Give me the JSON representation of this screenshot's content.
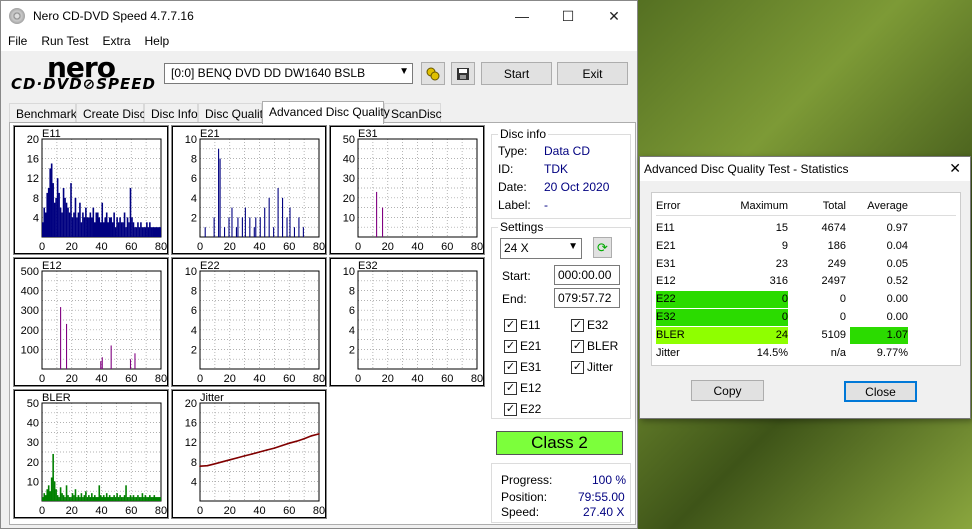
{
  "window": {
    "title": "Nero CD-DVD Speed 4.7.7.16",
    "min": "—",
    "max": "☐",
    "close": "✕"
  },
  "menu": [
    "File",
    "Run Test",
    "Extra",
    "Help"
  ],
  "logo": {
    "top": "nero",
    "bottom": "CD·DVD⊘SPEED"
  },
  "drive": {
    "value": "[0:0]   BENQ DVD DD DW1640 BSLB"
  },
  "buttons": {
    "start": "Start",
    "exit": "Exit"
  },
  "tabs": [
    "Benchmark",
    "Create Disc",
    "Disc Info",
    "Disc Quality",
    "Advanced Disc Quality",
    "ScanDisc"
  ],
  "active_tab": "Advanced Disc Quality",
  "disc_info": {
    "label": "Disc info",
    "rows": [
      {
        "k": "Type:",
        "v": "Data CD"
      },
      {
        "k": "ID:",
        "v": "TDK"
      },
      {
        "k": "Date:",
        "v": "20 Oct 2020"
      },
      {
        "k": "Label:",
        "v": "-"
      }
    ]
  },
  "settings": {
    "label": "Settings",
    "speed": "24 X",
    "start_label": "Start:",
    "start": "000:00.00",
    "end_label": "End:",
    "end": "079:57.72",
    "checks": [
      {
        "label": "E11",
        "checked": true
      },
      {
        "label": "E32",
        "checked": true
      },
      {
        "label": "E21",
        "checked": true
      },
      {
        "label": "BLER",
        "checked": true
      },
      {
        "label": "E31",
        "checked": true
      },
      {
        "label": "Jitter",
        "checked": true
      },
      {
        "label": "E12",
        "checked": true
      },
      {
        "label": "E22",
        "checked": true
      }
    ]
  },
  "class": "Class 2",
  "progress": {
    "progress_label": "Progress:",
    "progress": "100 %",
    "position_label": "Position:",
    "position": "79:55.00",
    "speed_label": "Speed:",
    "speed": "27.40 X"
  },
  "chart_data": [
    {
      "name": "E11",
      "type": "bar",
      "yticks": [
        "20",
        "16",
        "12",
        "8",
        "4"
      ],
      "xticks": [
        "0",
        "20",
        "40",
        "60",
        "80"
      ],
      "ylim": [
        0,
        20
      ],
      "color": "#000080",
      "values": [
        3,
        6,
        5,
        9,
        10,
        14,
        15,
        11,
        7,
        8,
        12,
        9,
        6,
        5,
        10,
        8,
        7,
        6,
        5,
        11,
        4,
        5,
        8,
        4,
        5,
        7,
        3,
        5,
        4,
        6,
        4,
        4,
        5,
        4,
        6,
        3,
        5,
        5,
        4,
        3,
        7,
        3,
        4,
        5,
        3,
        4,
        4,
        3,
        5,
        2,
        4,
        3,
        4,
        3,
        3,
        5,
        2,
        4,
        3,
        10,
        4,
        3,
        2,
        2,
        3,
        2,
        3,
        2,
        2,
        2,
        3,
        2,
        3,
        2,
        2,
        2,
        2,
        2,
        2,
        2
      ]
    },
    {
      "name": "E21",
      "type": "bar",
      "yticks": [
        "10",
        "8",
        "6",
        "4",
        "2"
      ],
      "xticks": [
        "0",
        "20",
        "40",
        "60",
        "80"
      ],
      "ylim": [
        0,
        10
      ],
      "color": "#000080",
      "values": [
        0,
        0,
        0,
        1,
        0,
        0,
        0,
        0,
        0,
        2,
        0,
        0,
        9,
        8,
        0,
        0,
        1,
        0,
        0,
        2,
        0,
        3,
        0,
        0,
        1,
        2,
        0,
        0,
        2,
        0,
        3,
        0,
        0,
        2,
        0,
        0,
        1,
        2,
        0,
        0,
        2,
        0,
        0,
        3,
        0,
        0,
        4,
        0,
        0,
        1,
        0,
        0,
        5,
        0,
        0,
        4,
        0,
        0,
        2,
        0,
        3,
        0,
        0,
        1,
        0,
        0,
        2,
        0,
        0,
        1,
        0,
        0,
        0,
        0,
        0,
        0,
        0,
        0,
        0,
        0
      ]
    },
    {
      "name": "E31",
      "type": "bar",
      "yticks": [
        "50",
        "40",
        "30",
        "20",
        "10"
      ],
      "xticks": [
        "0",
        "20",
        "40",
        "60",
        "80"
      ],
      "ylim": [
        0,
        50
      ],
      "color": "#800080",
      "values": [
        0,
        0,
        0,
        0,
        0,
        0,
        0,
        0,
        0,
        0,
        0,
        0,
        23,
        0,
        0,
        0,
        15,
        0,
        0,
        0,
        0,
        0,
        0,
        0,
        0,
        0,
        0,
        0,
        0,
        0,
        0,
        0,
        0,
        0,
        0,
        0,
        0,
        0,
        0,
        0,
        0,
        0,
        0,
        0,
        0,
        0,
        0,
        0,
        0,
        0,
        0,
        0,
        0,
        0,
        0,
        0,
        0,
        0,
        0,
        0,
        0,
        0,
        0,
        0,
        0,
        0,
        0,
        0,
        0,
        0,
        0,
        0,
        0,
        0,
        0,
        0,
        0,
        0,
        0,
        0
      ]
    },
    {
      "name": "E12",
      "type": "bar",
      "yticks": [
        "500",
        "400",
        "300",
        "200",
        "100"
      ],
      "xticks": [
        "0",
        "20",
        "40",
        "60",
        "80"
      ],
      "ylim": [
        0,
        500
      ],
      "color": "#800080",
      "values": [
        0,
        0,
        0,
        0,
        0,
        0,
        0,
        0,
        0,
        0,
        0,
        0,
        316,
        0,
        0,
        0,
        230,
        0,
        0,
        0,
        0,
        0,
        0,
        0,
        0,
        0,
        0,
        0,
        0,
        0,
        0,
        0,
        0,
        0,
        0,
        0,
        0,
        0,
        0,
        40,
        60,
        0,
        0,
        0,
        0,
        0,
        120,
        0,
        0,
        0,
        0,
        0,
        0,
        0,
        0,
        0,
        0,
        0,
        0,
        50,
        0,
        0,
        80,
        0,
        0,
        0,
        0,
        0,
        0,
        0,
        0,
        0,
        0,
        0,
        0,
        0,
        0,
        0,
        0,
        0
      ]
    },
    {
      "name": "E22",
      "type": "bar",
      "yticks": [
        "10",
        "8",
        "6",
        "4",
        "2"
      ],
      "xticks": [
        "0",
        "20",
        "40",
        "60",
        "80"
      ],
      "ylim": [
        0,
        10
      ],
      "color": "#800080",
      "values": []
    },
    {
      "name": "E32",
      "type": "bar",
      "yticks": [
        "10",
        "8",
        "6",
        "4",
        "2"
      ],
      "xticks": [
        "0",
        "20",
        "40",
        "60",
        "80"
      ],
      "ylim": [
        0,
        10
      ],
      "color": "#800080",
      "values": []
    },
    {
      "name": "BLER",
      "type": "bar",
      "yticks": [
        "50",
        "40",
        "30",
        "20",
        "10"
      ],
      "xticks": [
        "0",
        "20",
        "40",
        "60",
        "80"
      ],
      "ylim": [
        0,
        50
      ],
      "color": "#008000",
      "values": [
        2,
        4,
        3,
        6,
        8,
        5,
        12,
        24,
        10,
        6,
        3,
        2,
        7,
        4,
        3,
        2,
        8,
        3,
        2,
        2,
        4,
        3,
        6,
        2,
        3,
        2,
        4,
        2,
        3,
        5,
        2,
        3,
        2,
        4,
        2,
        3,
        2,
        2,
        8,
        3,
        2,
        3,
        2,
        4,
        2,
        3,
        2,
        2,
        3,
        2,
        4,
        2,
        3,
        2,
        2,
        3,
        8,
        2,
        2,
        3,
        2,
        3,
        2,
        2,
        3,
        2,
        2,
        4,
        2,
        3,
        2,
        2,
        3,
        2,
        2,
        3,
        2,
        2,
        2,
        2
      ]
    },
    {
      "name": "Jitter",
      "type": "line",
      "yticks": [
        "20",
        "16",
        "12",
        "8",
        "4"
      ],
      "xticks": [
        "0",
        "20",
        "40",
        "60",
        "80"
      ],
      "ylim": [
        0,
        20
      ],
      "color": "#800000",
      "x": [
        0,
        5,
        10,
        15,
        20,
        25,
        30,
        35,
        40,
        45,
        50,
        55,
        60,
        65,
        70,
        75,
        80
      ],
      "values": [
        7.1,
        7.2,
        7.6,
        8.0,
        8.4,
        8.8,
        9.2,
        9.6,
        10.0,
        10.4,
        10.8,
        11.3,
        11.8,
        12.2,
        12.7,
        13.3,
        13.7
      ]
    }
  ],
  "stats": {
    "title": "Advanced Disc Quality Test - Statistics",
    "headers": [
      "Error",
      "Maximum",
      "Total",
      "Average"
    ],
    "rows": [
      {
        "e": "E11",
        "max": "15",
        "tot": "4674",
        "avg": "0.97"
      },
      {
        "e": "E21",
        "max": "9",
        "tot": "186",
        "avg": "0.04"
      },
      {
        "e": "E31",
        "max": "23",
        "tot": "249",
        "avg": "0.05"
      },
      {
        "e": "E12",
        "max": "316",
        "tot": "2497",
        "avg": "0.52"
      },
      {
        "e": "E22",
        "max": "0",
        "tot": "0",
        "avg": "0.00"
      },
      {
        "e": "E32",
        "max": "0",
        "tot": "0",
        "avg": "0.00"
      },
      {
        "e": "BLER",
        "max": "24",
        "tot": "5109",
        "avg": "1.07"
      },
      {
        "e": "Jitter",
        "max": "14.5%",
        "tot": "n/a",
        "avg": "9.77%"
      }
    ],
    "copy": "Copy",
    "close": "Close",
    "close_x": "✕"
  }
}
